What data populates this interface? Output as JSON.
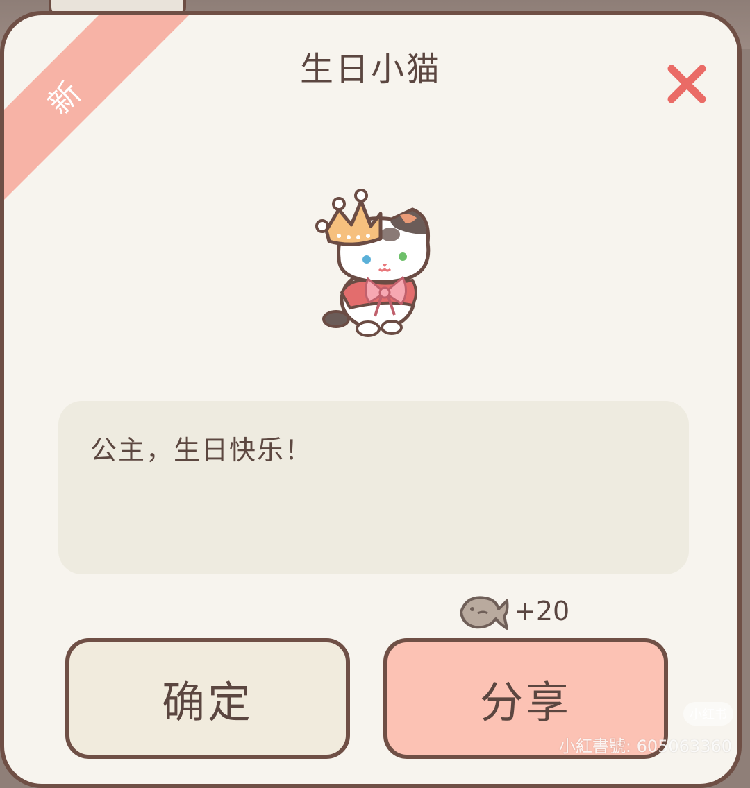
{
  "dialog": {
    "badge_new": "新",
    "title": "生日小猫",
    "close_icon": "close-x-icon",
    "cat_image": "crowned-calico-cat-with-pink-bow",
    "message": "公主，生日快乐！",
    "reward": {
      "icon": "fish-icon",
      "amount": "+20"
    },
    "buttons": {
      "confirm": "确定",
      "share": "分享"
    }
  },
  "watermark": {
    "badge": "小红书",
    "text": "小紅書號: 605063360"
  },
  "colors": {
    "panel": "#f7f4ee",
    "border": "#6f4f45",
    "ribbon": "#f7b3a6",
    "close": "#ea6b66",
    "confirm_bg": "#f1ebdd",
    "share_bg": "#fcc2b4",
    "message_bg": "#eeebe0"
  }
}
